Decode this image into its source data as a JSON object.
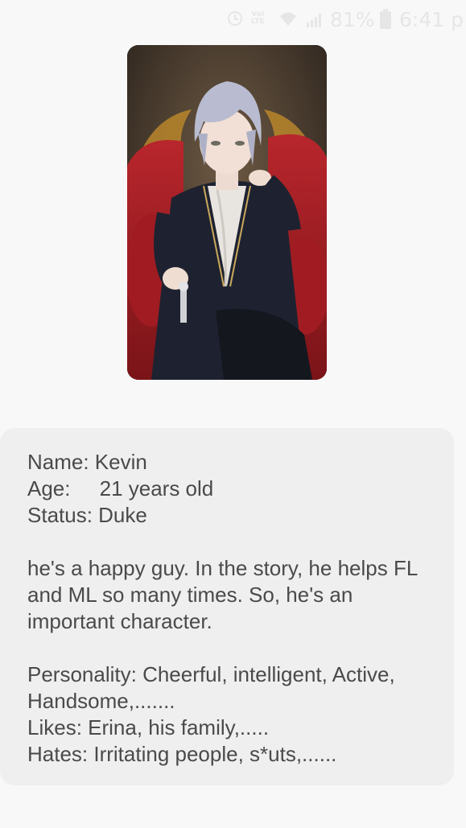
{
  "status_bar": {
    "volte_top": "VoI",
    "volte_bottom": "LTE",
    "battery_percent": "81%",
    "time": "6:41 p",
    "icons": [
      "alarm-icon",
      "volte-icon",
      "wifi-icon",
      "signal-icon",
      "battery-icon"
    ]
  },
  "character": {
    "image_icon": "character-portrait-image",
    "name_line": "Name: Kevin",
    "age_line": "Age:     21 years old",
    "status_line": "Status: Duke",
    "description": "he's a happy guy. In the story, he helps FL and ML so many times. So, he's an important character.",
    "personality_line": "Personality: Cheerful, intelligent, Active, Handsome,.......",
    "likes_line": "Likes: Erina, his family,.....",
    "hates_line": "Hates: Irritating people, s*uts,......"
  }
}
